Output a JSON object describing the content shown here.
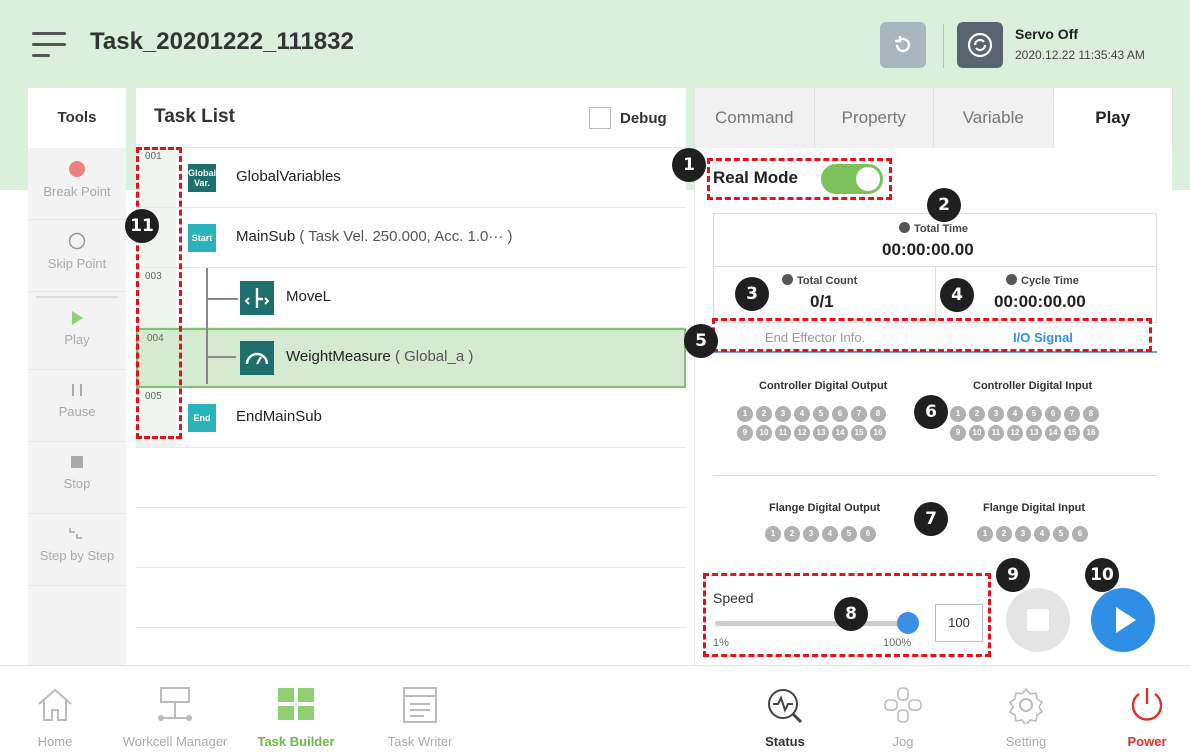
{
  "header": {
    "title": "Task_20201222_111832",
    "servo_status": "Servo Off",
    "datetime": "2020.12.22 11:35:43 AM"
  },
  "tools": {
    "heading": "Tools",
    "items": [
      "Break Point",
      "Skip Point",
      "Play",
      "Pause",
      "Stop",
      "Step by Step"
    ]
  },
  "task_list": {
    "heading": "Task List",
    "debug_label": "Debug",
    "rows": [
      {
        "num": "001",
        "badge": "Global Var.",
        "label": "GlobalVariables",
        "sub": ""
      },
      {
        "num": "",
        "badge": "Start",
        "label": "MainSub",
        "sub": "( Task Vel. 250.000, Acc. 1.0··· )"
      },
      {
        "num": "003",
        "badge": "",
        "label": "MoveL",
        "sub": ""
      },
      {
        "num": "004",
        "badge": "",
        "label": "WeightMeasure",
        "sub": "( Global_a )"
      },
      {
        "num": "005",
        "badge": "End",
        "label": "EndMainSub",
        "sub": ""
      }
    ]
  },
  "tabs": [
    "Command",
    "Property",
    "Variable",
    "Play"
  ],
  "play": {
    "real_mode_label": "Real Mode",
    "real_mode_on": true,
    "total_time_label": "Total Time",
    "total_time": "00:00:00.00",
    "total_count_label": "Total Count",
    "total_count": "0/1",
    "cycle_time_label": "Cycle Time",
    "cycle_time": "00:00:00.00",
    "subtabs": [
      "End Effector Info.",
      "I/O Signal"
    ],
    "controller_do_label": "Controller Digital Output",
    "controller_di_label": "Controller Digital Input",
    "flange_do_label": "Flange Digital Output",
    "flange_di_label": "Flange Digital Input",
    "controller_io_count": 16,
    "flange_io_count": 6,
    "speed_label": "Speed",
    "speed_min": "1%",
    "speed_max": "100%",
    "speed_value": "100",
    "speed_fraction": 1.0
  },
  "bottom_nav": [
    "Home",
    "Workcell Manager",
    "Task Builder",
    "Task Writer",
    "Status",
    "Jog",
    "Setting",
    "Power"
  ],
  "annotations": [
    "1",
    "2",
    "3",
    "4",
    "5",
    "6",
    "7",
    "8",
    "9",
    "10",
    "11"
  ],
  "colors": {
    "accent_green": "#7cc15b",
    "header_bg": "#dcefdc",
    "teal": "#1e6e6e",
    "play_blue": "#2f8fe6",
    "annotation_red": "#e0121b",
    "power_red": "#d9322b"
  }
}
